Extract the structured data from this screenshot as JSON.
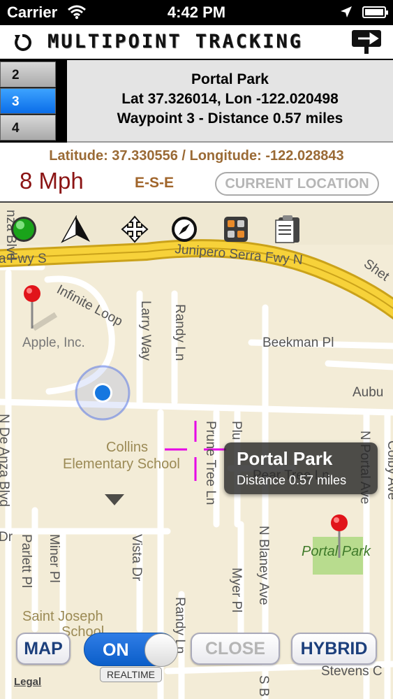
{
  "status_bar": {
    "carrier": "Carrier",
    "time": "4:42 PM"
  },
  "title_bar": {
    "title": "MULTIPOINT TRACKING"
  },
  "waypoints": {
    "items": [
      {
        "label": "2"
      },
      {
        "label": "3"
      },
      {
        "label": "4"
      }
    ],
    "selected": "3",
    "info": {
      "name": "Portal Park",
      "coords": "Lat 37.326014, Lon -122.020498",
      "distance": "Waypoint 3 - Distance 0.57 miles"
    }
  },
  "location": {
    "coords": "Latitude: 37.330556 / Longitude: -122.028843",
    "speed": "8 Mph",
    "heading": "E-S-E",
    "current_location_button": "CURRENT LOCATION"
  },
  "map": {
    "toolbar_icons": [
      "status-light-icon",
      "north-arrow-icon",
      "move-arrows-icon",
      "compass-icon",
      "calculator-icon",
      "clipboard-icon"
    ],
    "labels": {
      "junipero": "Junipero Serra Fwy N",
      "fwy_s": "a Fwy S",
      "infinite_loop": "Infinite Loop",
      "apple": "Apple, Inc.",
      "larry_way": "Larry Way",
      "randy_ln": "Randy Ln",
      "beekman": "Beekman Pl",
      "auburn": "Aubu",
      "collins": "Collins",
      "collins2": "Elementary School",
      "prune_tree": "Prune Tree Ln",
      "plum": "Plu",
      "pear_tree": "Pear Tree Ln",
      "n_portal": "N Portal Ave",
      "colby": "Colby Ave",
      "n_de_anza": "N De Anza Blvd",
      "parlett": "Parlett Pl",
      "miner": "Miner Pl",
      "vista": "Vista Dr",
      "myer": "Myer Pl",
      "n_blaney": "N Blaney Ave",
      "portal_park": "Portal Park",
      "saint_joseph": "Saint Joseph",
      "saint_joseph2": "School",
      "randy_ln2": "Randy Ln",
      "stevens": "Stevens C",
      "shet": "Shet",
      "anza_blvd": "nza Blvd",
      "s_blaney": "S B",
      "dr": "Dr"
    },
    "callout": {
      "title": "Portal Park",
      "subtitle": "Distance 0.57 miles"
    },
    "buttons": {
      "map": "MAP",
      "toggle": "ON",
      "toggle_on": true,
      "realtime": "REALTIME",
      "close": "CLOSE",
      "hybrid": "HYBRID"
    },
    "legal": "Legal"
  },
  "colors": {
    "selected_waypoint": "#0a6de8",
    "coords_text": "#9a6a35",
    "speed_text": "#8b1414",
    "freeway": "#f5c518",
    "crosshair": "#e600e6"
  }
}
